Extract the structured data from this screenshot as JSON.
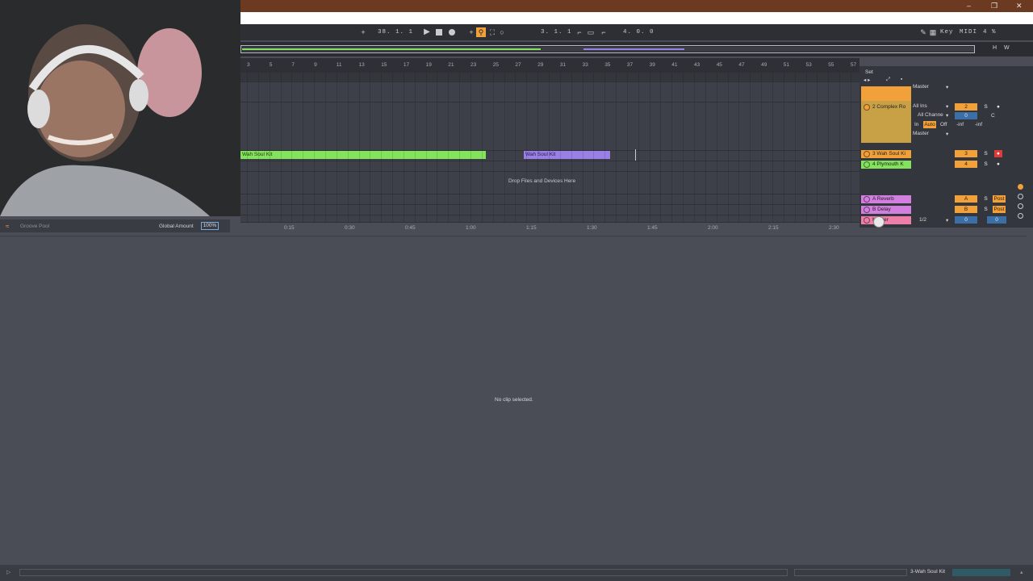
{
  "window": {
    "minimize": "–",
    "restore": "❐",
    "close": "✕"
  },
  "transport": {
    "arrangement_position": "38. 1. 1",
    "loop_start": "3. 1. 1",
    "loop_length": "4. 0. 0",
    "key_label": "Key",
    "midi_label": "MIDI",
    "cpu": "4 %",
    "h_label": "H",
    "w_label": "W"
  },
  "ruler": {
    "bars": [
      "3",
      "5",
      "7",
      "9",
      "11",
      "13",
      "15",
      "17",
      "19",
      "21",
      "23",
      "25",
      "27",
      "29",
      "31",
      "33",
      "35",
      "37",
      "39",
      "41",
      "43",
      "45",
      "47",
      "49",
      "51",
      "53",
      "55",
      "57"
    ]
  },
  "time_axis": {
    "labels": [
      "0:15",
      "0:30",
      "0:45",
      "1:00",
      "1:15",
      "1:30",
      "1:45",
      "2:00",
      "2:15",
      "2:30"
    ]
  },
  "arrangement": {
    "clips": [
      {
        "name": "Wah Soul Kit",
        "color": "#84e35c"
      },
      {
        "name": "Wah Soul Kit",
        "color": "#9a7fe6"
      }
    ],
    "drop_hint": "Drop Files and Devices Here"
  },
  "mixer": {
    "set_label": "Set",
    "output_master_1": "Master",
    "input_type": "All Ins",
    "input_channel": "All Channe",
    "monitor_in": "In",
    "monitor_auto": "Auto",
    "monitor_off": "Off",
    "output_master_2": "Master",
    "tracks": [
      {
        "name": "2 Complex Ro",
        "color": "#f2a13a",
        "number": "2"
      },
      {
        "name": "3 Wah Soul Ki",
        "color": "#f2a13a",
        "number": "3"
      },
      {
        "name": "4 Plymouth K",
        "color": "#84e35c",
        "number": "4"
      },
      {
        "name": "A Reverb",
        "color": "#d27fe0",
        "number": "A"
      },
      {
        "name": "B Delay",
        "color": "#d27fe0",
        "number": "B"
      },
      {
        "name": "Master",
        "color": "#ee7fa8",
        "number": "0"
      }
    ],
    "send_value": "0",
    "pan_center": "C",
    "inf_left": "-inf",
    "inf_right": "-inf",
    "solo": "S",
    "post": "Post",
    "cue_ratio": "1/2"
  },
  "groove": {
    "label": "Groove Pool",
    "amount_label": "Global Amount",
    "amount_value": "100%"
  },
  "detail": {
    "empty_message": "No clip selected."
  },
  "status": {
    "selected_track": "3-Wah Soul Kit"
  }
}
